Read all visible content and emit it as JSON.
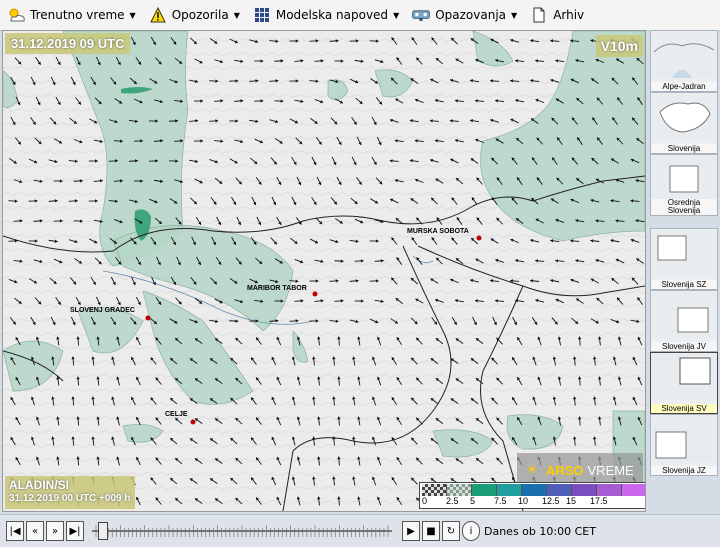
{
  "menu": [
    {
      "id": "current",
      "label": "Trenutno vreme",
      "icon": "sun-cloud-icon",
      "dropdown": true
    },
    {
      "id": "warnings",
      "label": "Opozorila",
      "icon": "warning-icon",
      "dropdown": true
    },
    {
      "id": "forecast",
      "label": "Modelska napoved",
      "icon": "grid-icon",
      "dropdown": true
    },
    {
      "id": "observations",
      "label": "Opazovanja",
      "icon": "station-icon",
      "dropdown": true
    },
    {
      "id": "archive",
      "label": "Arhiv",
      "icon": "document-icon",
      "dropdown": false
    }
  ],
  "map": {
    "datetime": "31.12.2019 09 UTC",
    "variable": "V10m",
    "model": "ALADIN/SI",
    "model_run": "31.12.2019 00 UTC +009 h",
    "logo_brand": "ARSO",
    "logo_text": "VREME",
    "cities": [
      {
        "name": "MURSKA SOBOTA"
      },
      {
        "name": "MARIBOR TABOR"
      },
      {
        "name": "SLOVENJ GRADEC"
      },
      {
        "name": "CELJE"
      }
    ],
    "legend": {
      "colors": [
        "#555555",
        "#7c9e8c",
        "#1a9e78",
        "#1e9e9e",
        "#1a6faf",
        "#4f5fb8",
        "#7a4ebe",
        "#a55cd0",
        "#cc66ee"
      ],
      "labels": [
        "0",
        "2.5",
        "5",
        "7.5",
        "10",
        "12.5",
        "15",
        "17.5"
      ],
      "hatch": [
        "#444444",
        "#7a9a8a"
      ]
    },
    "shade_color": "#b5d6c8"
  },
  "thumbnails": [
    {
      "label": "Alpe-Jadran",
      "active": false
    },
    {
      "label": "Slovenija",
      "active": false
    },
    {
      "label": "Osrednja Slovenija",
      "active": false
    },
    {
      "label": "Slovenija SZ",
      "active": false
    },
    {
      "label": "Slovenija JV",
      "active": false
    },
    {
      "label": "Slovenija SV",
      "active": true
    },
    {
      "label": "Slovenija JZ",
      "active": false
    }
  ],
  "player": {
    "status": "Danes ob 10:00 CET",
    "progress_fraction": 0.02
  }
}
